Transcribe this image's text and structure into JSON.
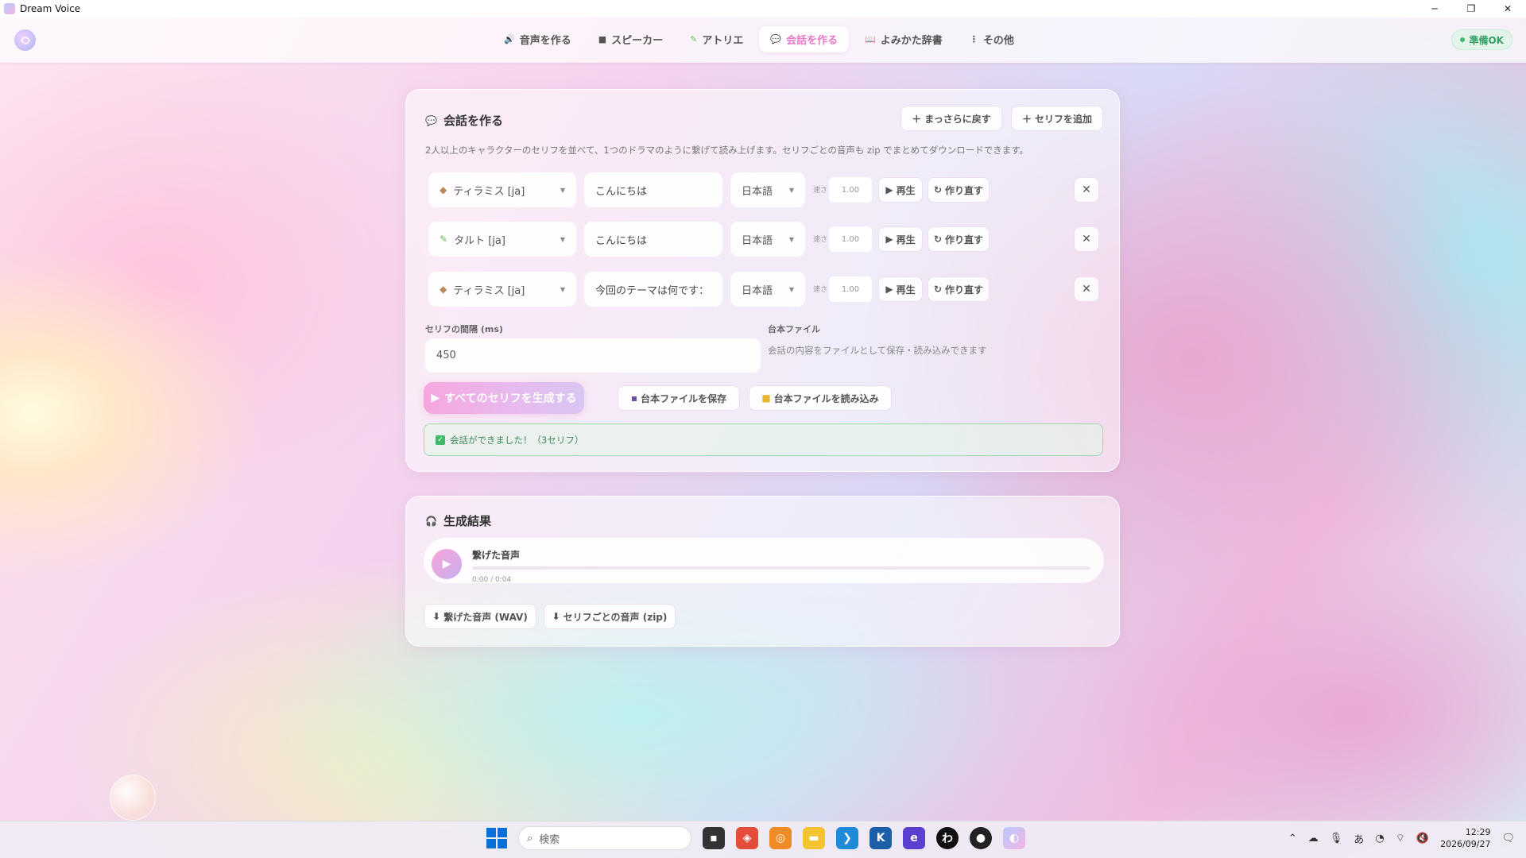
{
  "window": {
    "title": "Dream Voice",
    "controls": [
      "─",
      "❐",
      "✕"
    ]
  },
  "nav": {
    "tabs": [
      {
        "icon": "🔊",
        "label": "音声を作る"
      },
      {
        "icon": "■",
        "label": "スピーカー"
      },
      {
        "icon": "✎",
        "label": "アトリエ"
      },
      {
        "icon": "💬",
        "label": "会話を作る"
      },
      {
        "icon": "📖",
        "label": "よみかた辞書"
      },
      {
        "icon": "⋮",
        "label": "その他"
      }
    ],
    "active_tab": "会話を作る",
    "status": "準備OK"
  },
  "conversation": {
    "icon": "💬",
    "title": "会話を作る",
    "reset_label": "まっさらに戻す",
    "add_label": "セリフを追加",
    "description": "2人以上のキャラクターのセリフを並べて、1つのドラマのように繋げて読み上げます。セリフごとの音声も zip でまとめてダウンロードできます。",
    "speed_label": "速さ",
    "play_label": "再生",
    "regen_label": "作り直す",
    "lines": [
      {
        "speaker": "ティラミス [ja]",
        "speaker_icon": "cube",
        "text": "こんにちは",
        "language": "日本語",
        "speed": "1.00"
      },
      {
        "speaker": "タルト [ja]",
        "speaker_icon": "brush",
        "text": "こんにちは",
        "language": "日本語",
        "speed": "1.00"
      },
      {
        "speaker": "ティラミス [ja]",
        "speaker_icon": "cube",
        "text": "今回のテーマは何です：",
        "language": "日本語",
        "speed": "1.00"
      }
    ],
    "interval_label": "セリフの間隔 (ms)",
    "interval_value": "450",
    "script_label": "台本ファイル",
    "script_desc": "会話の内容をファイルとして保存・読み込みできます",
    "generate_label": "すべてのセリフを生成する",
    "save_label": "台本ファイルを保存",
    "load_label": "台本ファイルを読み込み",
    "success_message": "会話ができました！（3セリフ）"
  },
  "result": {
    "icon": "🎧",
    "title": "生成結果",
    "track_title": "繋げた音声",
    "time": "0:00 / 0:04",
    "progress": 0,
    "dl_wav": "繋げた音声 (WAV)",
    "dl_zip": "セリフごとの音声 (zip)"
  },
  "taskbar": {
    "search_placeholder": "検索",
    "time": "12:29",
    "date": "2026/09/27"
  },
  "colors": {
    "accent": "#e77ac7",
    "success": "#3fba6b",
    "status_bg": "#e3f4ea"
  }
}
